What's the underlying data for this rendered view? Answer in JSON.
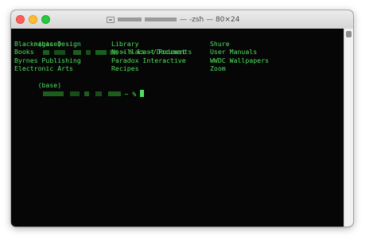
{
  "window": {
    "title": "— -zsh — 80×24"
  },
  "terminal": {
    "line1": {
      "prefix": "(base)",
      "prompt_suffix": " ~ % ",
      "command": "ls ~/Documents"
    },
    "files": [
      [
        "Blackmagic Design",
        "Library",
        "Shure"
      ],
      [
        "Books",
        "Nosillacast Podcast",
        "User Manuals"
      ],
      [
        "Byrnes Publishing",
        "Paradox Interactive",
        "WWDC Wallpapers"
      ],
      [
        "Electronic Arts",
        "Recipes",
        "Zoom"
      ]
    ],
    "line_last": {
      "prefix": "(base)",
      "prompt_suffix": " ~ % "
    }
  },
  "colors": {
    "terminal_bg": "#060606",
    "terminal_text": "#4ee05f",
    "titlebar_bg": "#e3e3e3"
  }
}
